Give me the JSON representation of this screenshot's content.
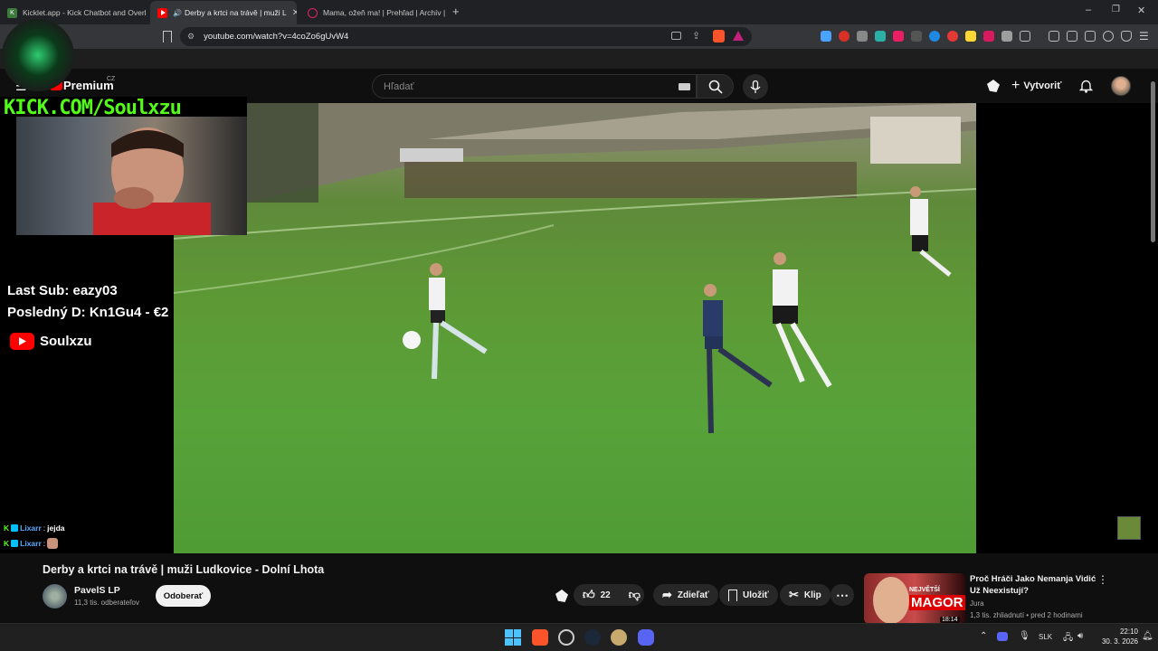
{
  "browser": {
    "tabs": [
      {
        "title": "Kicklet.app - Kick Chatbot and Overla",
        "favicon_color": "#3c7a3c"
      },
      {
        "title": "Derby a krtci na trávě | muži L",
        "favicon_color": "#ff0000",
        "active": true
      },
      {
        "title": "Mama, ožeň ma! | Prehľad | Archív | T",
        "favicon_color": "#e0245e"
      }
    ],
    "new_tab_symbol": "+",
    "url": "youtube.com/watch?v=4coZo6gUvW4"
  },
  "youtube": {
    "logo_text": "Premium",
    "region": "CZ",
    "search_placeholder": "Hľadať",
    "create_label": "Vytvoriť"
  },
  "overlay": {
    "kick_banner": "KICK.COM/Soulxzu",
    "last_sub": "Last Sub: eazy03",
    "last_donation": "Posledný D: Kn1Gu4 - €2",
    "youtube_channel": "Soulxzu",
    "chat": [
      {
        "user": "Lixarr",
        "message": "jejda"
      },
      {
        "user": "Lixarr",
        "message": ""
      }
    ]
  },
  "video": {
    "title": "Derby a krtci na trávě | muži Ludkovice - Dolní Lhota",
    "channel": "PavelS LP",
    "subscribers": "11,3 tis. odberateľov",
    "subscribe_label": "Odoberať",
    "likes": "22",
    "share_label": "Zdieľať",
    "save_label": "Uložiť",
    "clip_label": "Klip"
  },
  "recommended": {
    "title": "Proč Hráči Jako Nemanja Vidić Už Neexistují?",
    "channel": "Jura",
    "meta": "1,3 tis. zhliadnutí • pred 2 hodinami",
    "thumb_label_small": "NEJVĚTŠÍ",
    "thumb_label_big": "MAGOR",
    "duration": "18:14"
  },
  "taskbar": {
    "language": "SLK",
    "time": "22:10",
    "date": "30. 3. 2026"
  },
  "colors": {
    "youtube_red": "#ff0000",
    "kick_green": "#53fc18"
  }
}
